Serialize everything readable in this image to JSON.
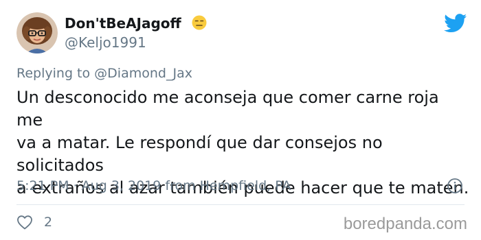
{
  "author": {
    "display_name": "Don'tBeAJagoff",
    "handle": "@Keljo1991",
    "avatar": "memoji-avatar",
    "emoji": "expressionless-face-emoji"
  },
  "header": {
    "logo": "twitter-bird-icon"
  },
  "reply": {
    "prefix": "Replying to",
    "mention": "@Diamond_Jax"
  },
  "tweet": {
    "text": "Un desconocido me aconseja que comer carne roja me\nva a matar.  Le respondí que dar consejos no solicitados\na extraños al azar también puede hacer que te maten."
  },
  "meta": {
    "line": "5:21 PM · Aug 3, 2019 from Hempfield, PA",
    "info_icon": "info-icon"
  },
  "engagement": {
    "like_icon": "heart-icon",
    "like_count": "2"
  },
  "watermark": "boredpanda.com",
  "colors": {
    "text": "#14171a",
    "secondary": "#657786",
    "twitter_blue": "#1da1f2",
    "divider": "#e1e8ed",
    "watermark": "#9a9a9a"
  }
}
